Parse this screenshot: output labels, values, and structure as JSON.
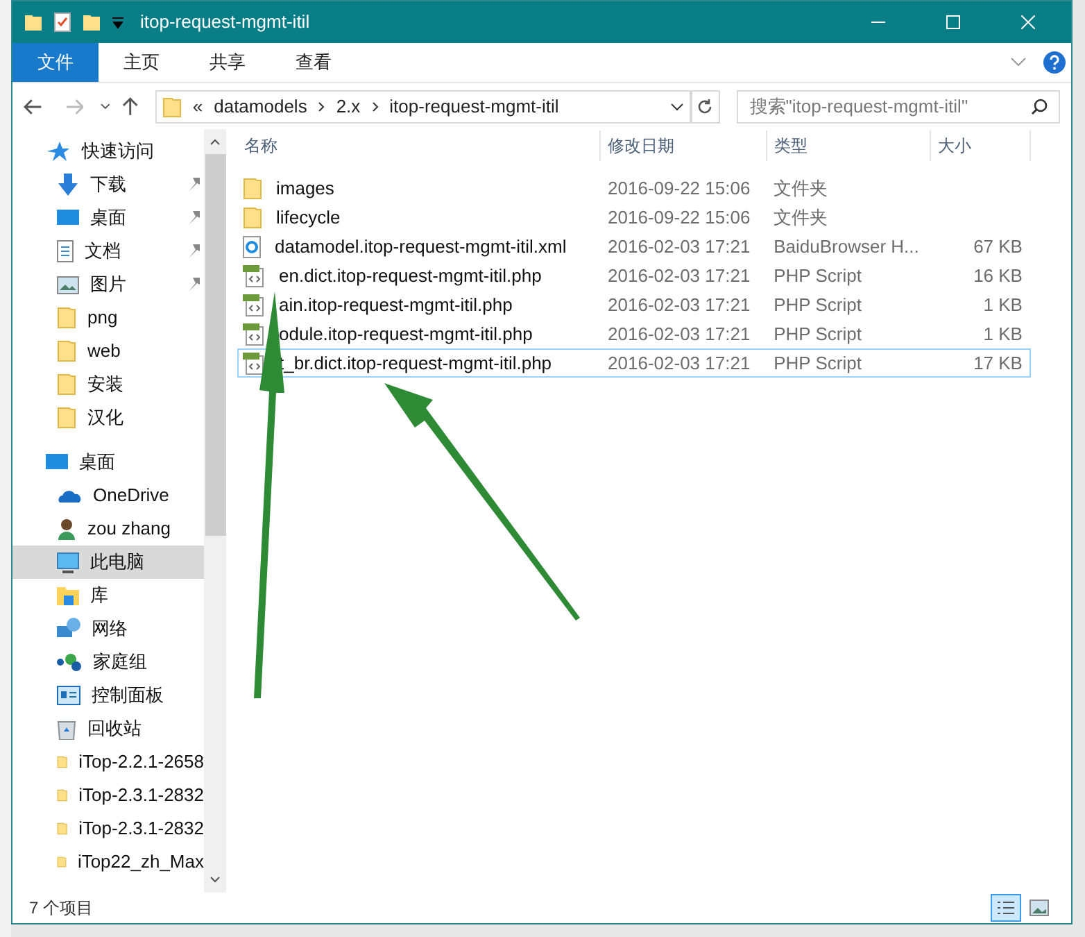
{
  "window": {
    "title": "itop-request-mgmt-itil"
  },
  "ribbon_tabs": [
    {
      "label": "文件",
      "selected": true
    },
    {
      "label": "主页",
      "selected": false
    },
    {
      "label": "共享",
      "selected": false
    },
    {
      "label": "查看",
      "selected": false
    }
  ],
  "address": {
    "overflow": "«",
    "path": [
      "datamodels",
      "2.x",
      "itop-request-mgmt-itil"
    ]
  },
  "search": {
    "placeholder": "搜索\"itop-request-mgmt-itil\""
  },
  "sidebar": {
    "items": [
      {
        "label": "快速访问",
        "kind": "quick",
        "pinned": false,
        "selected": false
      },
      {
        "label": "下载",
        "kind": "download",
        "pinned": true,
        "selected": false
      },
      {
        "label": "桌面",
        "kind": "desktop",
        "pinned": true,
        "selected": false
      },
      {
        "label": "文档",
        "kind": "docs",
        "pinned": true,
        "selected": false
      },
      {
        "label": "图片",
        "kind": "pictures",
        "pinned": true,
        "selected": false
      },
      {
        "label": "png",
        "kind": "folder",
        "pinned": false,
        "selected": false
      },
      {
        "label": "web",
        "kind": "folder",
        "pinned": false,
        "selected": false
      },
      {
        "label": "安装",
        "kind": "folder",
        "pinned": false,
        "selected": false
      },
      {
        "label": "汉化",
        "kind": "folder",
        "pinned": false,
        "selected": false
      },
      {
        "label": "桌面",
        "kind": "desktop-root",
        "pinned": false,
        "selected": false
      },
      {
        "label": "OneDrive",
        "kind": "onedrive",
        "pinned": false,
        "selected": false
      },
      {
        "label": "zou zhang",
        "kind": "user",
        "pinned": false,
        "selected": false
      },
      {
        "label": "此电脑",
        "kind": "pc",
        "pinned": false,
        "selected": true
      },
      {
        "label": "库",
        "kind": "library",
        "pinned": false,
        "selected": false
      },
      {
        "label": "网络",
        "kind": "network",
        "pinned": false,
        "selected": false
      },
      {
        "label": "家庭组",
        "kind": "homegroup",
        "pinned": false,
        "selected": false
      },
      {
        "label": "控制面板",
        "kind": "control",
        "pinned": false,
        "selected": false
      },
      {
        "label": "回收站",
        "kind": "recycle",
        "pinned": false,
        "selected": false
      },
      {
        "label": "iTop-2.2.1-2658",
        "kind": "folder",
        "pinned": false,
        "selected": false
      },
      {
        "label": "iTop-2.3.1-2832",
        "kind": "folder",
        "pinned": false,
        "selected": false
      },
      {
        "label": "iTop-2.3.1-2832",
        "kind": "folder",
        "pinned": false,
        "selected": false
      },
      {
        "label": "iTop22_zh_Max",
        "kind": "folder",
        "pinned": false,
        "selected": false
      }
    ]
  },
  "table": {
    "columns": [
      "名称",
      "修改日期",
      "类型",
      "大小"
    ],
    "rows": [
      {
        "kind": "folder",
        "name": "images",
        "date": "2016-09-22 15:06",
        "type": "文件夹",
        "size": "",
        "selected": false
      },
      {
        "kind": "folder",
        "name": "lifecycle",
        "date": "2016-09-22 15:06",
        "type": "文件夹",
        "size": "",
        "selected": false
      },
      {
        "kind": "xml",
        "name": "datamodel.itop-request-mgmt-itil.xml",
        "date": "2016-02-03 17:21",
        "type": "BaiduBrowser H...",
        "size": "67 KB",
        "selected": false
      },
      {
        "kind": "php",
        "name": "en.dict.itop-request-mgmt-itil.php",
        "date": "2016-02-03 17:21",
        "type": "PHP Script",
        "size": "16 KB",
        "selected": false
      },
      {
        "kind": "php",
        "name": "ain.itop-request-mgmt-itil.php",
        "date": "2016-02-03 17:21",
        "type": "PHP Script",
        "size": "1 KB",
        "selected": false
      },
      {
        "kind": "php",
        "name": "odule.itop-request-mgmt-itil.php",
        "date": "2016-02-03 17:21",
        "type": "PHP Script",
        "size": "1 KB",
        "selected": false
      },
      {
        "kind": "php",
        "name": "t_br.dict.itop-request-mgmt-itil.php",
        "date": "2016-02-03 17:21",
        "type": "PHP Script",
        "size": "17 KB",
        "selected": true
      }
    ]
  },
  "status_bar": {
    "text": "7 个项目"
  },
  "view_buttons": [
    {
      "kind": "details",
      "selected": true
    },
    {
      "kind": "thumbnails",
      "selected": false
    }
  ]
}
